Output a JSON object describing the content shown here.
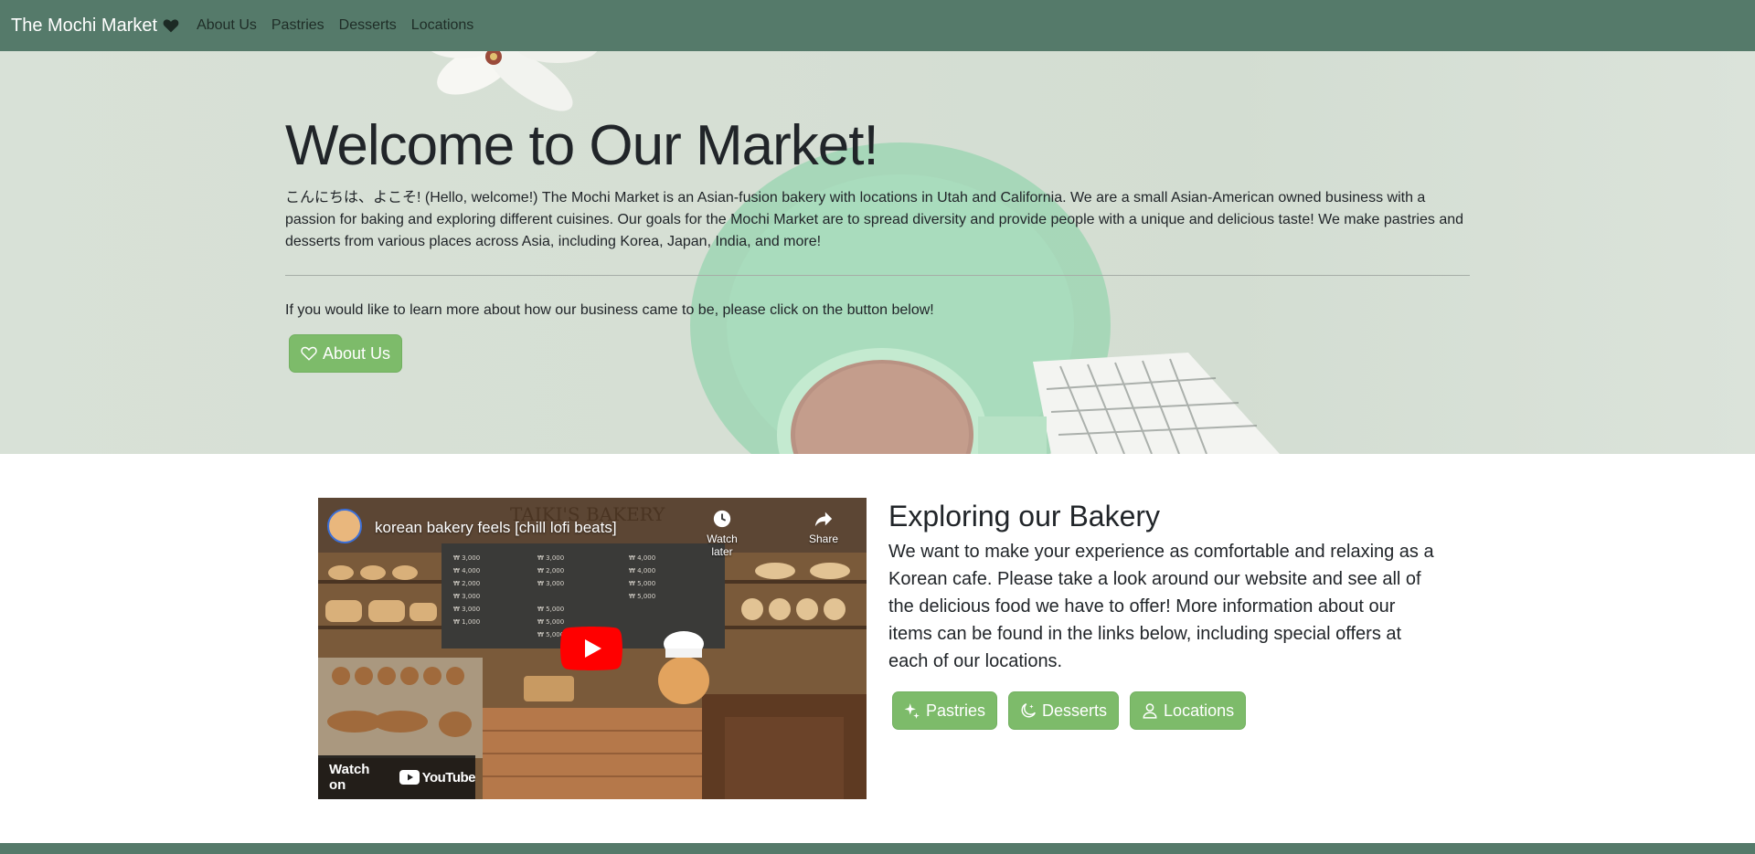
{
  "navbar": {
    "brand": "The Mochi Market",
    "brand_icon": "heart-icon",
    "links": [
      "About Us",
      "Pastries",
      "Desserts",
      "Locations"
    ]
  },
  "hero": {
    "title": "Welcome to Our Market!",
    "lead": "こんにちは、よこそ!  (Hello, welcome!) The Mochi Market is an Asian-fusion bakery with locations in Utah and California. We are a small Asian-American owned business with a passion for baking and exploring different cuisines. Our goals for the Mochi Market are to spread diversity and provide people with a unique and delicious taste! We make pastries and desserts from various places across Asia, including Korea, Japan, India, and more!",
    "note": "If you would like to learn more about how our business came to be, please click on the button below!",
    "button_label": "About Us",
    "button_icon": "heart-outline-icon"
  },
  "video": {
    "title": "korean bakery feels [chill lofi beats]",
    "watch_later": "Watch later",
    "share": "Share",
    "watch_on": "Watch on",
    "youtube": "YouTube",
    "sign": "TAIKI'S BAKERY"
  },
  "explore": {
    "title": "Exploring our Bakery",
    "text": "We want to make your experience as comfortable and relaxing as a Korean cafe. Please take a look around our website and see all of the delicious food we have to offer! More information about our items can be found in the links below, including special offers at each of our locations.",
    "buttons": [
      {
        "label": "Pastries",
        "icon": "stars-icon"
      },
      {
        "label": "Desserts",
        "icon": "moon-stars-icon"
      },
      {
        "label": "Locations",
        "icon": "person-pin-icon"
      }
    ]
  },
  "colors": {
    "navbar": "#557a6a",
    "button": "#7dbb6a",
    "hero_bg": "#d6dfd4"
  }
}
